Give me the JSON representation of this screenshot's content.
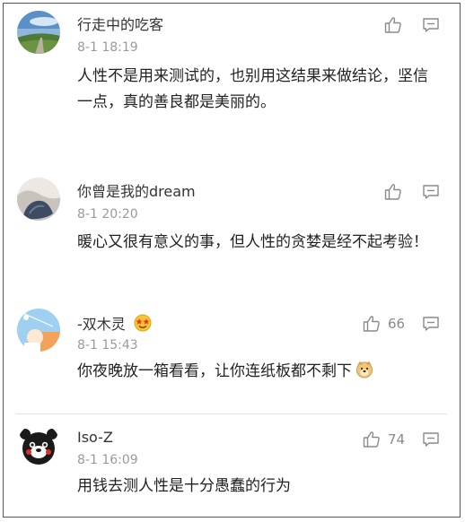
{
  "comments": [
    {
      "username": "行走中的吃客",
      "time": "8-1 18:19",
      "text": "人性不是用来测试的，也别用这结果来做结论，坚信一点，真的善良都是美丽的。",
      "likes": ""
    },
    {
      "username": "你曾是我的dream",
      "time": "8-1 20:20",
      "text": "暖心又很有意义的事，但人性的贪婪是经不起考验！",
      "likes": ""
    },
    {
      "username": "-双木灵",
      "time": "8-1 15:43",
      "text": "你夜晚放一箱看看，让你连纸板都不剩下",
      "likes": "66"
    },
    {
      "username": "Iso-Z",
      "time": "8-1 16:09",
      "text": "用钱去测人性是十分愚蠢的行为",
      "likes": "74"
    }
  ],
  "icons": {
    "like": "thumbs-up-icon",
    "reply": "comment-icon"
  },
  "colors": {
    "name": "#333333",
    "time": "#9a9a9a",
    "text": "#222222",
    "icon": "#8a8a8a"
  }
}
